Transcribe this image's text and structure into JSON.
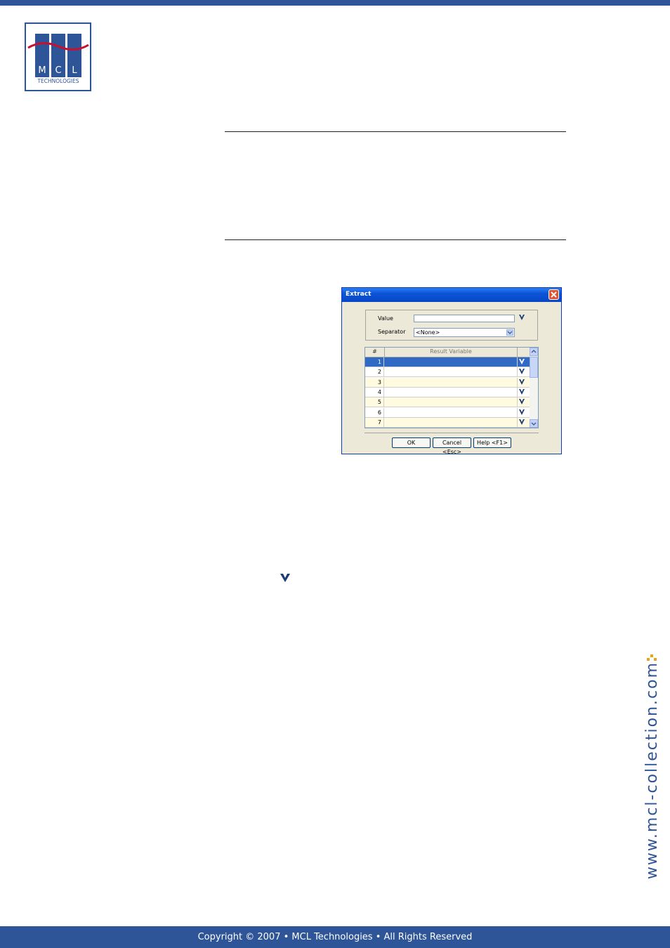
{
  "header": {
    "logo": {
      "letters": [
        "M",
        "C",
        "L"
      ],
      "subtitle": "TECHNOLOGIES"
    }
  },
  "dialog": {
    "title": "Extract",
    "value_label": "Value",
    "value_input": "",
    "separator_label": "Separator",
    "separator_value": "<None>",
    "grid": {
      "columns": [
        "#",
        "Result Variable"
      ],
      "rows": [
        {
          "num": "1",
          "var": ""
        },
        {
          "num": "2",
          "var": ""
        },
        {
          "num": "3",
          "var": ""
        },
        {
          "num": "4",
          "var": ""
        },
        {
          "num": "5",
          "var": ""
        },
        {
          "num": "6",
          "var": ""
        },
        {
          "num": "7",
          "var": ""
        }
      ],
      "selected_row": 1
    },
    "buttons": {
      "ok": "OK",
      "cancel": "Cancel <Esc>",
      "help": "Help <F1>"
    }
  },
  "sidebar_url": "www.mcl-collection.com",
  "footer": {
    "copyright": "Copyright © 2007 • MCL Technologies • All Rights Reserved"
  },
  "colors": {
    "brand": "#2e5597",
    "accent": "#e9a21b",
    "check": "#1c3c74"
  }
}
